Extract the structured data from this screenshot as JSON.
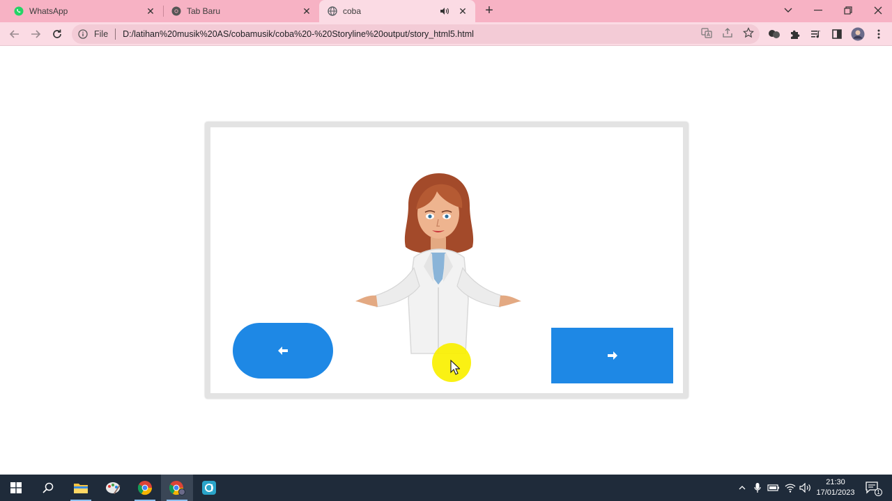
{
  "browser": {
    "tabs": [
      {
        "title": "WhatsApp",
        "icon": "whatsapp-icon",
        "active": false
      },
      {
        "title": "Tab Baru",
        "icon": "chrome-icon",
        "active": false
      },
      {
        "title": "coba",
        "icon": "globe-icon",
        "active": true,
        "audio": true
      }
    ],
    "address": {
      "scheme_label": "File",
      "url": "D:/latihan%20musik%20AS/cobamusik/coba%20-%20Storyline%20output/story_html5.html"
    }
  },
  "story": {
    "prev_icon": "arrow-left-icon",
    "next_icon": "arrow-right-icon",
    "character": "doctor-woman-illustration"
  },
  "taskbar": {
    "apps": [
      "start-icon",
      "search-icon",
      "file-explorer-icon",
      "paint-icon",
      "chrome-icon",
      "chrome-profile-icon",
      "app-icon"
    ],
    "clock": {
      "time": "21:30",
      "date": "17/01/2023"
    },
    "notification_count": "1"
  },
  "colors": {
    "tab_strip": "#f7b2c4",
    "toolbar": "#fbdbe4",
    "button_blue": "#1e88e5",
    "taskbar": "#1f2b3a",
    "cursor_highlight": "#faf000"
  }
}
